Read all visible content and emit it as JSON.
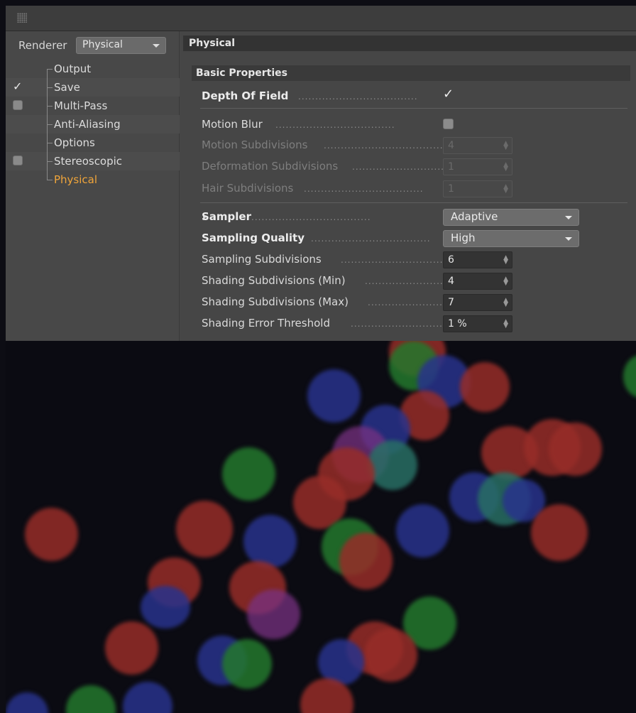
{
  "renderer": {
    "label": "Renderer",
    "selected": "Physical"
  },
  "tree": {
    "items": [
      {
        "label": "Output",
        "checkbox": "none"
      },
      {
        "label": "Save",
        "checkbox": "checked"
      },
      {
        "label": "Multi-Pass",
        "checkbox": "unchecked"
      },
      {
        "label": "Anti-Aliasing",
        "checkbox": "none"
      },
      {
        "label": "Options",
        "checkbox": "none"
      },
      {
        "label": "Stereoscopic",
        "checkbox": "unchecked"
      },
      {
        "label": "Physical",
        "checkbox": "none",
        "active": true
      }
    ]
  },
  "section": {
    "title": "Physical"
  },
  "basic": {
    "title": "Basic Properties",
    "depth_of_field": {
      "label": "Depth Of Field",
      "checked": true
    },
    "motion_blur": {
      "label": "Motion Blur",
      "checked": false
    },
    "motion_subdivisions": {
      "label": "Motion Subdivisions",
      "value": "4"
    },
    "deformation_subdivisions": {
      "label": "Deformation Subdivisions",
      "value": "1"
    },
    "hair_subdivisions": {
      "label": "Hair Subdivisions",
      "value": "1"
    },
    "sampler": {
      "label": "Sampler",
      "value": "Adaptive"
    },
    "sampling_quality": {
      "label": "Sampling Quality",
      "value": "High"
    },
    "sampling_subdivisions": {
      "label": "Sampling Subdivisions",
      "value": "6"
    },
    "shading_min": {
      "label": "Shading Subdivisions (Min)",
      "value": "4"
    },
    "shading_max": {
      "label": "Shading Subdivisions (Max)",
      "value": "7"
    },
    "shading_error": {
      "label": "Shading Error Threshold",
      "value": "1 %"
    }
  },
  "icons": {
    "grip": "grip-dots-icon",
    "check": "checkmark-icon",
    "dropdown": "chevron-down-icon",
    "spinner": "spinner-arrows-icon",
    "expander": "triangle-right-icon"
  },
  "colors": {
    "panel_bg": "#464646",
    "active_item": "#f0a53a",
    "render_bg": "#0b0b12"
  }
}
